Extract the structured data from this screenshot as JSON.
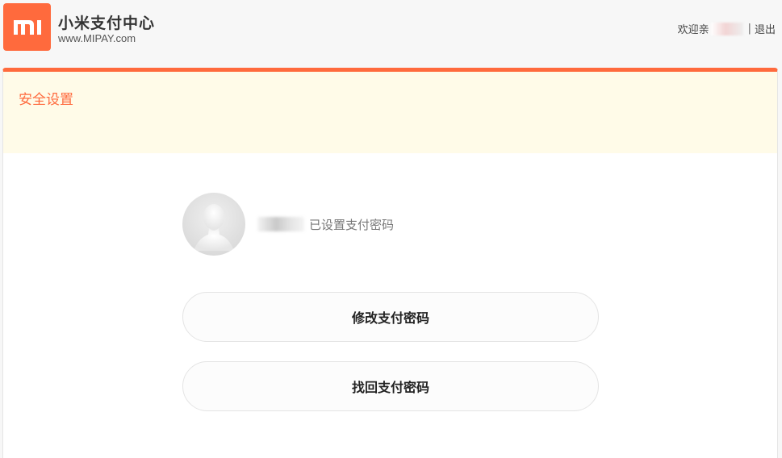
{
  "brand": {
    "title": "小米支付中心",
    "url": "www.MIPAY.com",
    "logo_icon": "mi-logo-icon",
    "accent_color": "#ff6a3d"
  },
  "user": {
    "welcome": "欢迎亲",
    "separator": "|",
    "logout_label": "退出"
  },
  "panel": {
    "title": "安全设置",
    "status_text": "已设置支付密码",
    "avatar_icon": "default-avatar-icon"
  },
  "actions": {
    "change_password": "修改支付密码",
    "recover_password": "找回支付密码"
  }
}
